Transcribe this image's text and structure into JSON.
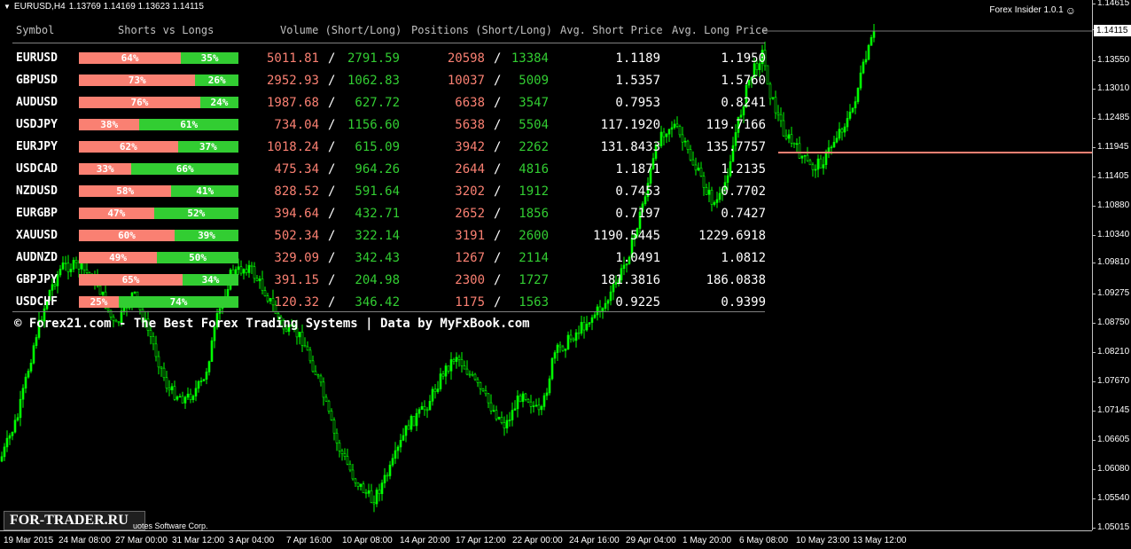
{
  "symbol_header": {
    "symbol_timeframe": "EURUSD,H4",
    "ohlc": "1.13769 1.14169 1.13623 1.14115"
  },
  "indicator": {
    "name": "Forex Insider 1.0.1",
    "icon": "smiley-icon"
  },
  "current_price": "1.14115",
  "price_axis": [
    "1.14615",
    "1.14115",
    "1.13550",
    "1.13010",
    "1.12485",
    "1.11945",
    "1.11405",
    "1.10880",
    "1.10340",
    "1.09810",
    "1.09275",
    "1.08750",
    "1.08210",
    "1.07670",
    "1.07145",
    "1.06605",
    "1.06080",
    "1.05540",
    "1.05015"
  ],
  "time_axis": [
    "19 Mar 2015",
    "24 Mar 08:00",
    "27 Mar 00:00",
    "31 Mar 12:00",
    "3 Apr 04:00",
    "7 Apr 16:00",
    "10 Apr 08:00",
    "14 Apr 20:00",
    "17 Apr 12:00",
    "22 Apr 00:00",
    "24 Apr 16:00",
    "29 Apr 04:00",
    "1 May 20:00",
    "6 May 08:00",
    "10 May 23:00",
    "13 May 12:00"
  ],
  "table": {
    "headers": {
      "symbol": "Symbol",
      "shorts_vs_longs": "Shorts vs Longs",
      "volume": "Volume (Short/Long)",
      "positions": "Positions (Short/Long)",
      "avg_short": "Avg. Short Price",
      "avg_long": "Avg. Long Price"
    },
    "separator": "/",
    "rows": [
      {
        "symbol": "EURUSD",
        "short_pct": "64%",
        "long_pct": "35%",
        "short_frac": 0.64,
        "vol_short": "5011.81",
        "vol_long": "2791.59",
        "pos_short": "20598",
        "pos_long": "13384",
        "avg_short": "1.1189",
        "avg_long": "1.1950"
      },
      {
        "symbol": "GBPUSD",
        "short_pct": "73%",
        "long_pct": "26%",
        "short_frac": 0.73,
        "vol_short": "2952.93",
        "vol_long": "1062.83",
        "pos_short": "10037",
        "pos_long": "5009",
        "avg_short": "1.5357",
        "avg_long": "1.5760"
      },
      {
        "symbol": "AUDUSD",
        "short_pct": "76%",
        "long_pct": "24%",
        "short_frac": 0.76,
        "vol_short": "1987.68",
        "vol_long": "627.72",
        "pos_short": "6638",
        "pos_long": "3547",
        "avg_short": "0.7953",
        "avg_long": "0.8241"
      },
      {
        "symbol": "USDJPY",
        "short_pct": "38%",
        "long_pct": "61%",
        "short_frac": 0.38,
        "vol_short": "734.04",
        "vol_long": "1156.60",
        "pos_short": "5638",
        "pos_long": "5504",
        "avg_short": "117.1920",
        "avg_long": "119.7166"
      },
      {
        "symbol": "EURJPY",
        "short_pct": "62%",
        "long_pct": "37%",
        "short_frac": 0.62,
        "vol_short": "1018.24",
        "vol_long": "615.09",
        "pos_short": "3942",
        "pos_long": "2262",
        "avg_short": "131.8433",
        "avg_long": "135.7757"
      },
      {
        "symbol": "USDCAD",
        "short_pct": "33%",
        "long_pct": "66%",
        "short_frac": 0.33,
        "vol_short": "475.34",
        "vol_long": "964.26",
        "pos_short": "2644",
        "pos_long": "4816",
        "avg_short": "1.1871",
        "avg_long": "1.2135"
      },
      {
        "symbol": "NZDUSD",
        "short_pct": "58%",
        "long_pct": "41%",
        "short_frac": 0.58,
        "vol_short": "828.52",
        "vol_long": "591.64",
        "pos_short": "3202",
        "pos_long": "1912",
        "avg_short": "0.7453",
        "avg_long": "0.7702"
      },
      {
        "symbol": "EURGBP",
        "short_pct": "47%",
        "long_pct": "52%",
        "short_frac": 0.47,
        "vol_short": "394.64",
        "vol_long": "432.71",
        "pos_short": "2652",
        "pos_long": "1856",
        "avg_short": "0.7197",
        "avg_long": "0.7427"
      },
      {
        "symbol": "XAUUSD",
        "short_pct": "60%",
        "long_pct": "39%",
        "short_frac": 0.6,
        "vol_short": "502.34",
        "vol_long": "322.14",
        "pos_short": "3191",
        "pos_long": "2600",
        "avg_short": "1190.5445",
        "avg_long": "1229.6918"
      },
      {
        "symbol": "AUDNZD",
        "short_pct": "49%",
        "long_pct": "50%",
        "short_frac": 0.49,
        "vol_short": "329.09",
        "vol_long": "342.43",
        "pos_short": "1267",
        "pos_long": "2114",
        "avg_short": "1.0491",
        "avg_long": "1.0812"
      },
      {
        "symbol": "GBPJPY",
        "short_pct": "65%",
        "long_pct": "34%",
        "short_frac": 0.65,
        "vol_short": "391.15",
        "vol_long": "204.98",
        "pos_short": "2300",
        "pos_long": "1727",
        "avg_short": "181.3816",
        "avg_long": "186.0838"
      },
      {
        "symbol": "USDCHF",
        "short_pct": "25%",
        "long_pct": "74%",
        "short_frac": 0.25,
        "vol_short": "120.32",
        "vol_long": "346.42",
        "pos_short": "1175",
        "pos_long": "1563",
        "avg_short": "0.9225",
        "avg_long": "0.9399"
      }
    ],
    "footer": "© Forex21.com - The Best Forex Trading Systems | Data by MyFxBook.com"
  },
  "watermark": "FOR-TRADER.RU",
  "copyright": "uotes Software Corp.",
  "colors": {
    "short": "#fa8072",
    "long": "#32cd32",
    "candle": "#00ff00",
    "hline": "#fa8072"
  }
}
